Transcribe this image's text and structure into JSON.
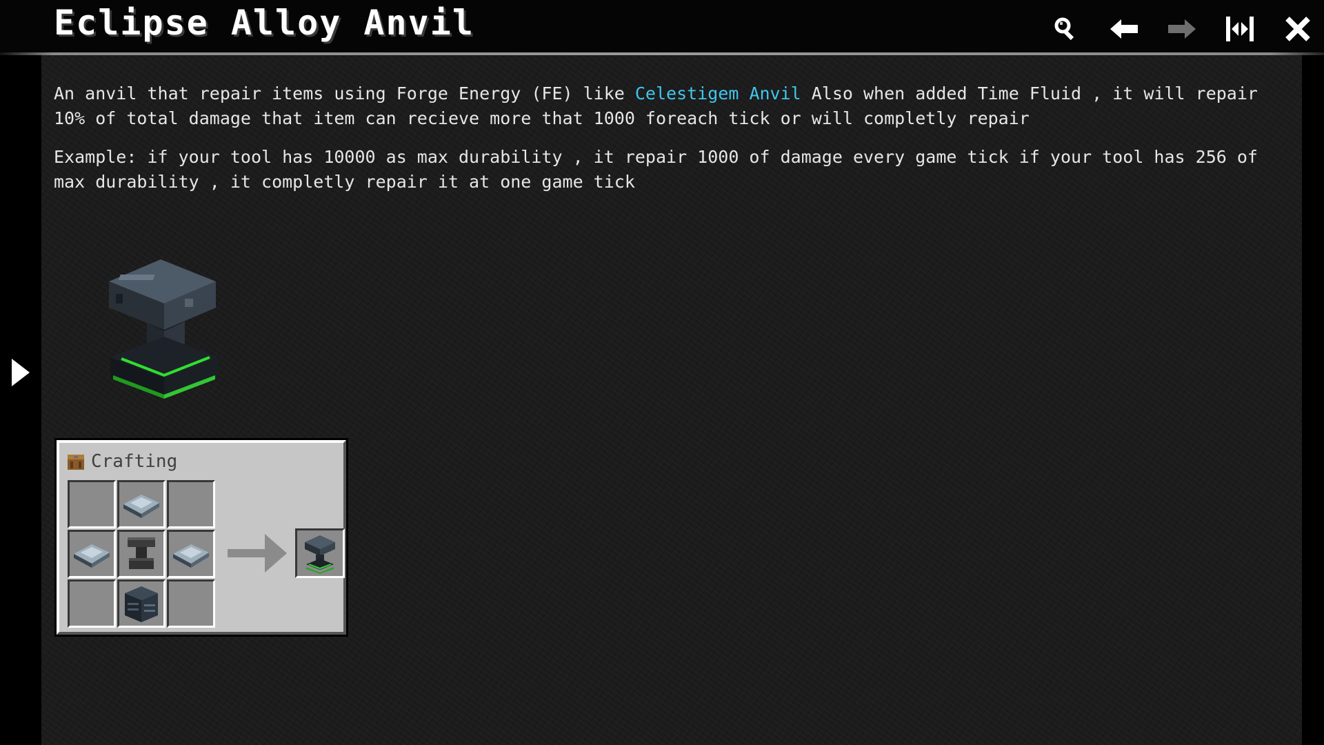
{
  "window": {
    "title": "Eclipse Alloy Anvil"
  },
  "toolbar": {
    "buttons": [
      {
        "name": "search",
        "icon": "search-icon"
      },
      {
        "name": "back",
        "icon": "arrow-left-icon"
      },
      {
        "name": "forward",
        "icon": "arrow-right-icon"
      },
      {
        "name": "collapse",
        "icon": "collapse-icon"
      },
      {
        "name": "close",
        "icon": "close-icon"
      }
    ]
  },
  "sidebar": {
    "toggle_icon": "triangle-right-icon"
  },
  "description": {
    "p1_before_link": "An anvil that repair items using Forge Energy (FE) like ",
    "p1_link": "Celestigem Anvil",
    "p1_after_link": " Also when added Time Fluid , it will repair 10% of total damage that item can recieve more that 1000 foreach tick or will completly repair",
    "p2": "Example: if your tool has 10000 as max durability , it repair 1000 of damage every game tick if your tool has 256 of max durability , it completly repair it at one game tick"
  },
  "preview": {
    "item_icon": "eclipse-alloy-anvil-icon"
  },
  "crafting": {
    "label": "Crafting",
    "header_icon": "crafting-table-icon",
    "grid": [
      "",
      "eclipse-alloy-ingot-icon",
      "",
      "eclipse-alloy-ingot-icon",
      "anvil-icon",
      "eclipse-alloy-ingot-icon",
      "",
      "eclipse-alloy-block-icon",
      ""
    ],
    "arrow_icon": "arrow-right-icon",
    "output_icon": "eclipse-alloy-anvil-icon"
  },
  "colors": {
    "link": "#3fc7ee",
    "text": "#e6e6e6",
    "panel_bg": "#1c1c1c",
    "craft_bg": "#c6c6c6",
    "accent_green": "#2fe02f"
  }
}
